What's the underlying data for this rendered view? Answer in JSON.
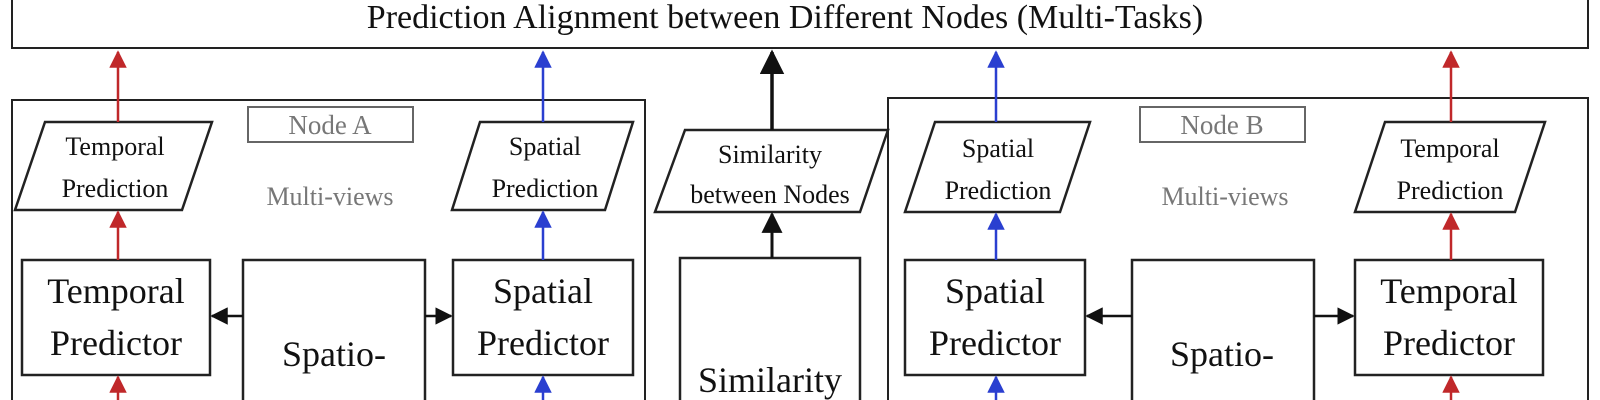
{
  "title": "Prediction Alignment between Different Nodes (Multi-Tasks)",
  "colors": {
    "red_arrow": "#c0282a",
    "blue_arrow": "#2a3fd0",
    "black_arrow": "#111111",
    "gray_text": "#777777"
  },
  "node_a": {
    "label": "Node A",
    "views": "Multi-views",
    "temporal_prediction": [
      "Temporal",
      "Prediction"
    ],
    "spatial_prediction": [
      "Spatial",
      "Prediction"
    ],
    "temporal_predictor": [
      "Temporal",
      "Predictor"
    ],
    "spatial_predictor": [
      "Spatial",
      "Predictor"
    ],
    "encoder": "Spatio-"
  },
  "similarity": {
    "output": [
      "Similarity",
      "between Nodes"
    ],
    "module": "Similarity"
  },
  "node_b": {
    "label": "Node B",
    "views": "Multi-views",
    "temporal_prediction": [
      "Temporal",
      "Prediction"
    ],
    "spatial_prediction": [
      "Spatial",
      "Prediction"
    ],
    "temporal_predictor": [
      "Temporal",
      "Predictor"
    ],
    "spatial_predictor": [
      "Spatial",
      "Predictor"
    ],
    "encoder": "Spatio-"
  }
}
